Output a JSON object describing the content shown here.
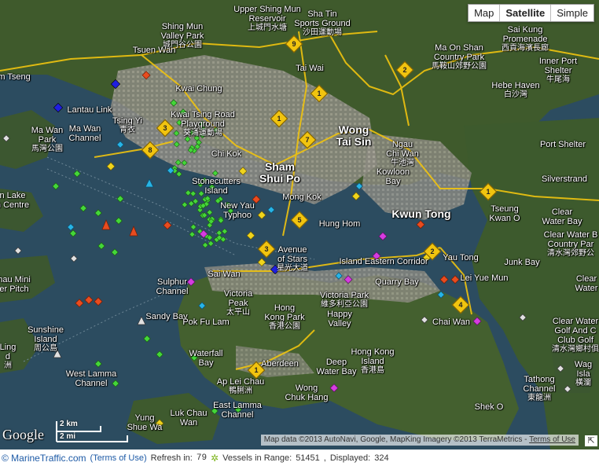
{
  "map_type": {
    "options": [
      "Map",
      "Satellite",
      "Simple"
    ],
    "selected": "Satellite"
  },
  "labels": [
    {
      "id": "shing-mun",
      "en": "Shing Mun\nValley Park",
      "zh": "城門谷公園"
    },
    {
      "id": "upper-shing-mun",
      "en": "Upper Shing Mun\nReservoir",
      "zh": "上城門水塘"
    },
    {
      "id": "sha-tin-sports",
      "en": "Sha Tin\nSports Ground",
      "zh": "沙田運動場"
    },
    {
      "id": "sai-kung",
      "en": "Sai Kung\nPromenade",
      "zh": "西貢海濱長廊"
    },
    {
      "id": "ma-on-shan",
      "en": "Ma On Shan\nCountry Park",
      "zh": "馬鞍山郊野公園"
    },
    {
      "id": "inner-port-shelter",
      "en": "Inner Port\nShelter",
      "zh": "牛尾海"
    },
    {
      "id": "hebe-haven",
      "en": "Hebe Haven",
      "zh": "白沙灣"
    },
    {
      "id": "tsuen-wan",
      "en": "Tsuen Wan",
      "zh": ""
    },
    {
      "id": "tai-wai",
      "en": "Tai Wai",
      "zh": ""
    },
    {
      "id": "kwai-chung",
      "en": "Kwai Chung",
      "zh": ""
    },
    {
      "id": "tam-tseng",
      "en": "am Tseng",
      "zh": ""
    },
    {
      "id": "kwai-tsing",
      "en": "Kwai Tsing Road\nPlayground",
      "zh": "葵涌運動場"
    },
    {
      "id": "tsing-yi",
      "en": "Tsing Yi",
      "zh": "青衣"
    },
    {
      "id": "ma-wan",
      "en": "Ma Wan\nPark",
      "zh": "馬灣公園"
    },
    {
      "id": "ma-wan-channel",
      "en": "Ma Wan\nChannel",
      "zh": ""
    },
    {
      "id": "wong-tai-sin",
      "en": "Wong\nTai Sin",
      "zh": ""
    },
    {
      "id": "ngau-chi-wan",
      "en": "Ngau\nChi Wan",
      "zh": "牛池灣"
    },
    {
      "id": "port-shelter",
      "en": "Port Shelter",
      "zh": ""
    },
    {
      "id": "kowloon-bay",
      "en": "Kowloon\nBay",
      "zh": ""
    },
    {
      "id": "silverstrand",
      "en": "Silverstrand",
      "zh": ""
    },
    {
      "id": "chi-kok",
      "en": "Chi Kok",
      "zh": ""
    },
    {
      "id": "sham-shui-po",
      "en": "Sham\nShui Po",
      "zh": ""
    },
    {
      "id": "stonecutters",
      "en": "Stonecutters\nIsland",
      "zh": ""
    },
    {
      "id": "mong-kok",
      "en": "Mong Kok",
      "zh": ""
    },
    {
      "id": "kwun-tong",
      "en": "Kwun Tong",
      "zh": ""
    },
    {
      "id": "tseung-kwan-o",
      "en": "Tseung\nKwan O",
      "zh": ""
    },
    {
      "id": "clear-water-bay",
      "en": "Clear\nWater Bay",
      "zh": ""
    },
    {
      "id": "lantau-centre",
      "en": "n Lake\nn Centre",
      "zh": ""
    },
    {
      "id": "new-yau-typhoon",
      "en": "New Yau\nTyphoo",
      "zh": ""
    },
    {
      "id": "hung-hom",
      "en": "Hung Hom",
      "zh": ""
    },
    {
      "id": "clear-water-bay-cp",
      "en": "Clear Water B\nCountry Par",
      "zh": "清水灣郊野公"
    },
    {
      "id": "avenue-of-stars",
      "en": "Avenue\nof Stars",
      "zh": "星光大道"
    },
    {
      "id": "island-eastern",
      "en": "Island Eastern Corridor",
      "zh": ""
    },
    {
      "id": "yau-tong",
      "en": "Yau Tong",
      "zh": ""
    },
    {
      "id": "junk-bay",
      "en": "Junk Bay",
      "zh": ""
    },
    {
      "id": "clear-water-bay-2",
      "en": "Clear\nWater",
      "zh": ""
    },
    {
      "id": "sulphur",
      "en": "Sulphur\nChannel",
      "zh": ""
    },
    {
      "id": "sai-wan",
      "en": "Sai Wan",
      "zh": ""
    },
    {
      "id": "victoria-park",
      "en": "Victoria Park",
      "zh": "維多利亞公園"
    },
    {
      "id": "quarry-bay",
      "en": "Quarry Bay",
      "zh": ""
    },
    {
      "id": "lei-yue-mun",
      "en": "Lei Yue Mun",
      "zh": ""
    },
    {
      "id": "hau-mini",
      "en": "hau Mini\ner Pitch",
      "zh": ""
    },
    {
      "id": "victoria-peak",
      "en": "Victoria\nPeak",
      "zh": "太平山"
    },
    {
      "id": "hong-kong-park",
      "en": "Hong\nKong Park",
      "zh": "香港公園"
    },
    {
      "id": "happy-valley",
      "en": "Happy\nValley",
      "zh": ""
    },
    {
      "id": "sandy-bay",
      "en": "Sandy Bay",
      "zh": ""
    },
    {
      "id": "pok-fu-lam",
      "en": "Pok Fu Lam",
      "zh": ""
    },
    {
      "id": "chai-wan",
      "en": "Chai Wan",
      "zh": ""
    },
    {
      "id": "clear-water-golf",
      "en": "Clear Water\nGolf And C\nClub Golf",
      "zh": "清水灣鄉村俱"
    },
    {
      "id": "sunshine-island",
      "en": "Sunshine\nIsland",
      "zh": "周公島"
    },
    {
      "id": "ling-island",
      "en": "Ling\nd",
      "zh": "洲"
    },
    {
      "id": "hong-kong-island",
      "en": "Hong Kong\nIsland",
      "zh": "香港島"
    },
    {
      "id": "waterfall-bay",
      "en": "Waterfall\nBay",
      "zh": ""
    },
    {
      "id": "deep-water-bay",
      "en": "Deep\nWater Bay",
      "zh": ""
    },
    {
      "id": "aberdeen",
      "en": "Aberdeen",
      "zh": ""
    },
    {
      "id": "waglan",
      "en": "Wag\nIsla",
      "zh": "橫瀾"
    },
    {
      "id": "west-lamma",
      "en": "West Lamma\nChannel",
      "zh": ""
    },
    {
      "id": "lei-chau",
      "en": "Ap Lei Chau",
      "zh": "鴨脷洲"
    },
    {
      "id": "tathong",
      "en": "Tathong\nChannel",
      "zh": "東龍洲"
    },
    {
      "id": "wong-chuk-hang",
      "en": "Wong\nChuk Hang",
      "zh": ""
    },
    {
      "id": "shek-o",
      "en": "Shek O",
      "zh": ""
    },
    {
      "id": "east-lamma",
      "en": "East Lamma\nChannel",
      "zh": ""
    },
    {
      "id": "luk-chau",
      "en": "Luk Chau\nWan",
      "zh": ""
    },
    {
      "id": "yung-shue",
      "en": "Yung\nShue Wa",
      "zh": ""
    },
    {
      "id": "lantau-link",
      "en": "Lantau Link",
      "zh": ""
    }
  ],
  "routes": [
    "9",
    "2",
    "1",
    "3",
    "8",
    "7",
    "5",
    "1",
    "2",
    "4",
    "3",
    "1",
    "1"
  ],
  "vessels": {
    "tanker": "#e84c1f",
    "cargo": "#44d639",
    "passenger": "#27b4e6",
    "highspeed": "#f0d41c",
    "pleasure": "#d63ce0",
    "other": "#cfcfcf",
    "navaid": "#1f1fe0"
  },
  "attribution": {
    "text": "Map data ©2013 AutoNavi, Google, MapKing Imagery ©2013 TerraMetrics - ",
    "terms": "Terms of Use"
  },
  "scale": {
    "km": "2 km",
    "mi": "2 mi"
  },
  "google_logo": "Google",
  "status": {
    "brand": "© MarineTraffic.com",
    "terms": "(Terms of Use)",
    "refresh_label": "Refresh in:",
    "refresh_value": "79",
    "vessels_label": "Vessels in Range:",
    "vessels_value": "51451",
    "displayed_label": "Displayed:",
    "displayed_value": "324"
  }
}
